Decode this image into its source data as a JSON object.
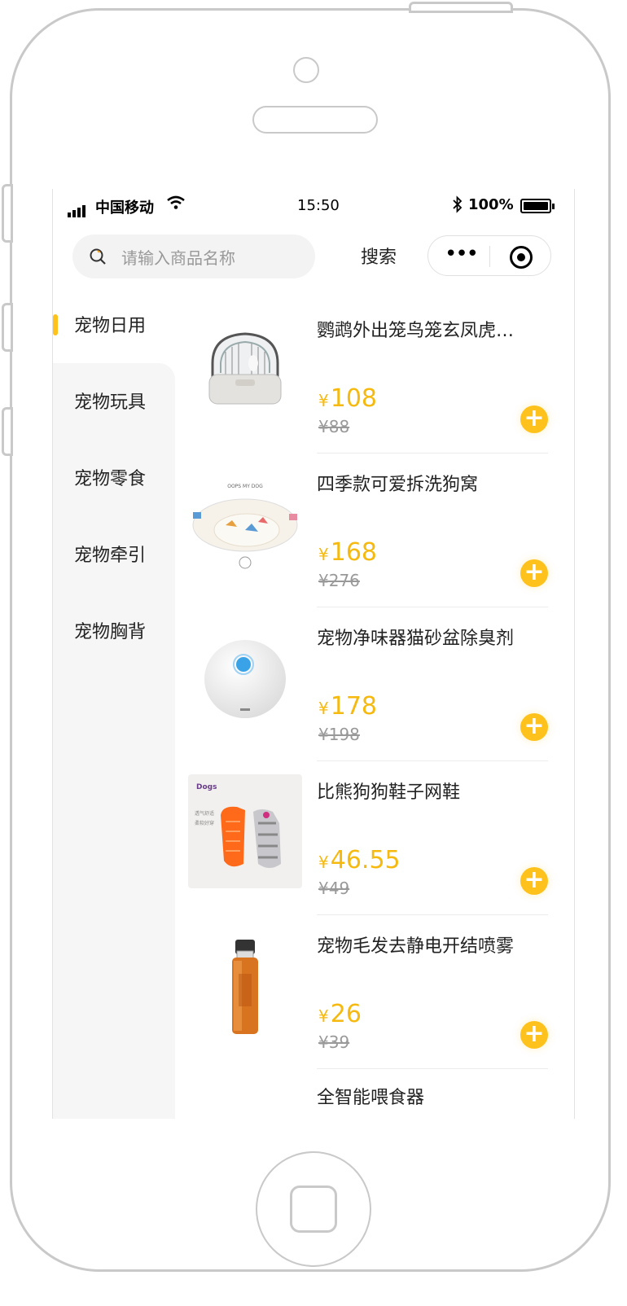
{
  "status_bar": {
    "carrier": "中国移动",
    "time": "15:50",
    "battery": "100%"
  },
  "search": {
    "placeholder": "请输入商品名称",
    "button_label": "搜索"
  },
  "categories": [
    {
      "label": "宠物日用",
      "active": true
    },
    {
      "label": "宠物玩具",
      "active": false
    },
    {
      "label": "宠物零食",
      "active": false
    },
    {
      "label": "宠物牵引",
      "active": false
    },
    {
      "label": "宠物胸背",
      "active": false
    }
  ],
  "currency_symbol": "¥",
  "products": [
    {
      "name": "鹦鹉外出笼鸟笼玄凤虎…",
      "price": "108",
      "old_price": "¥88"
    },
    {
      "name": "四季款可爱拆洗狗窝",
      "price": "168",
      "old_price": "¥276"
    },
    {
      "name": "宠物净味器猫砂盆除臭剂",
      "price": "178",
      "old_price": "¥198"
    },
    {
      "name": "比熊狗狗鞋子网鞋",
      "price": "46.55",
      "old_price": "¥49"
    },
    {
      "name": "宠物毛发去静电开结喷雾",
      "price": "26",
      "old_price": "¥39"
    }
  ],
  "partial_next_product_name": "全智能喂食器",
  "product_image_texts": {
    "dog_bed_brand": "OOPS MY DOG",
    "shoe_brand": "Dogs",
    "shoe_tagline_1": "透气舒适",
    "shoe_tagline_2": "柔软好穿"
  },
  "colors": {
    "accent": "#ffc21c",
    "price": "#f5b90f"
  }
}
